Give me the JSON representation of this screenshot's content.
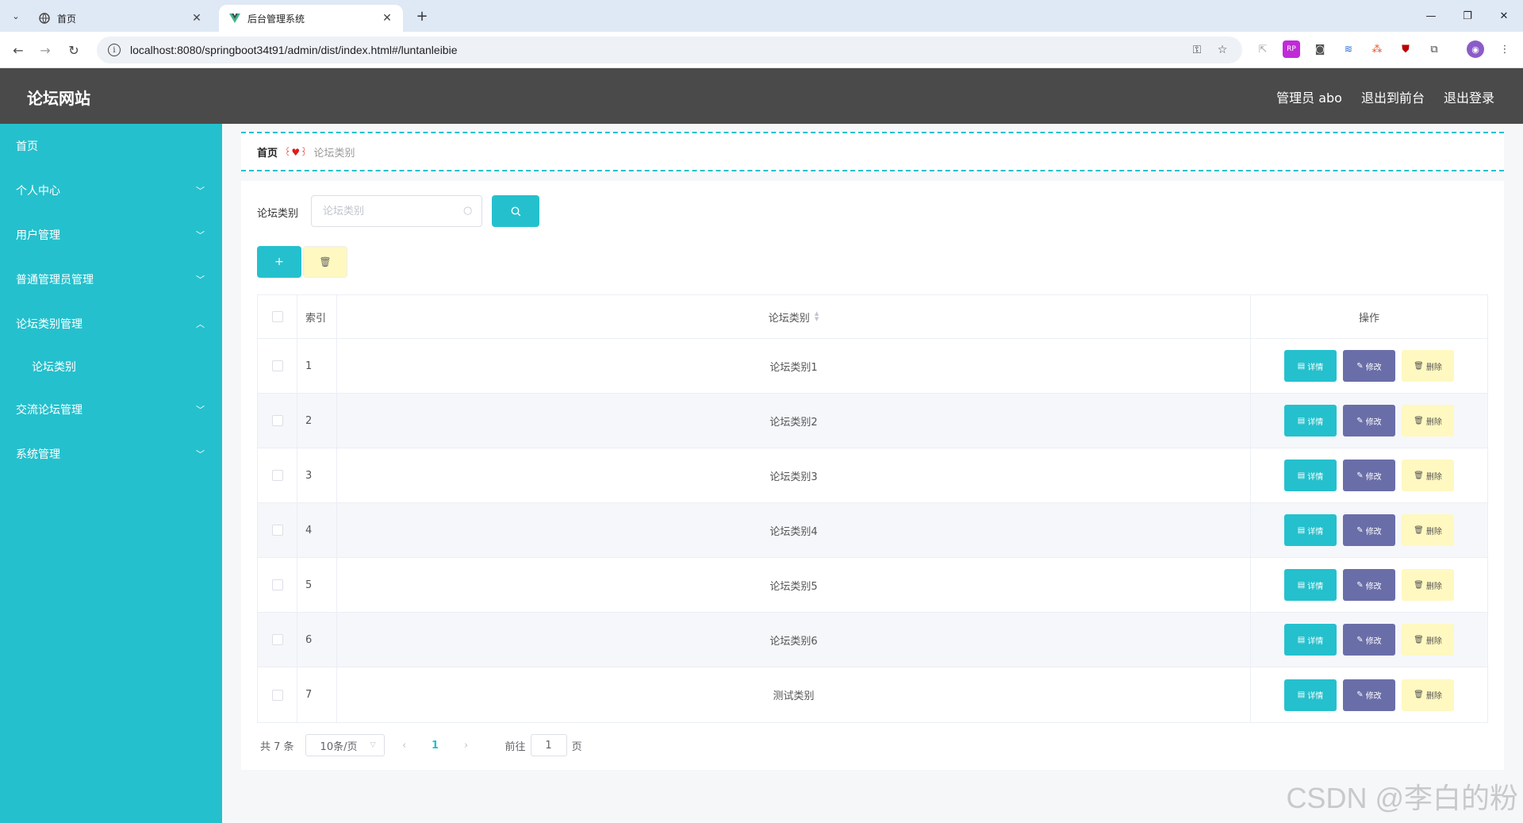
{
  "browser": {
    "tabs": [
      {
        "title": "首页",
        "icon": "globe-icon"
      },
      {
        "title": "后台管理系统",
        "icon": "vue-icon"
      }
    ],
    "url": "localhost:8080/springboot34t91/admin/dist/index.html#/luntanleibie"
  },
  "header": {
    "title": "论坛网站",
    "user": "管理员 abo",
    "to_front": "退出到前台",
    "logout": "退出登录",
    "bg_color": "#4a4a4a"
  },
  "sidebar": {
    "bg_color": "#25c0cd",
    "items": [
      {
        "label": "首页"
      },
      {
        "label": "个人中心"
      },
      {
        "label": "用户管理"
      },
      {
        "label": "普通管理员管理"
      },
      {
        "label": "论坛类别管理"
      },
      {
        "label": "论坛类别"
      },
      {
        "label": "交流论坛管理"
      },
      {
        "label": "系统管理"
      }
    ]
  },
  "breadcrumb": {
    "home": "首页",
    "separator": "꒰♥꒱",
    "current": "论坛类别"
  },
  "search": {
    "label": "论坛类别",
    "placeholder": "论坛类别"
  },
  "table": {
    "columns": [
      "索引",
      "论坛类别",
      "操作"
    ],
    "rows": [
      {
        "index": "1",
        "name": "论坛类别1"
      },
      {
        "index": "2",
        "name": "论坛类别2"
      },
      {
        "index": "3",
        "name": "论坛类别3"
      },
      {
        "index": "4",
        "name": "论坛类别4"
      },
      {
        "index": "5",
        "name": "论坛类别5"
      },
      {
        "index": "6",
        "name": "论坛类别6"
      },
      {
        "index": "7",
        "name": "测试类别"
      }
    ],
    "actions": {
      "detail": "详情",
      "edit": "修改",
      "delete": "删除"
    }
  },
  "pagination": {
    "total": "共 7 条",
    "page_size": "10条/页",
    "current_page": "1",
    "goto_prefix": "前往",
    "goto_value": "1",
    "goto_suffix": "页"
  },
  "watermark": "CSDN @李白的粉",
  "accent_color": "#25c0cd"
}
